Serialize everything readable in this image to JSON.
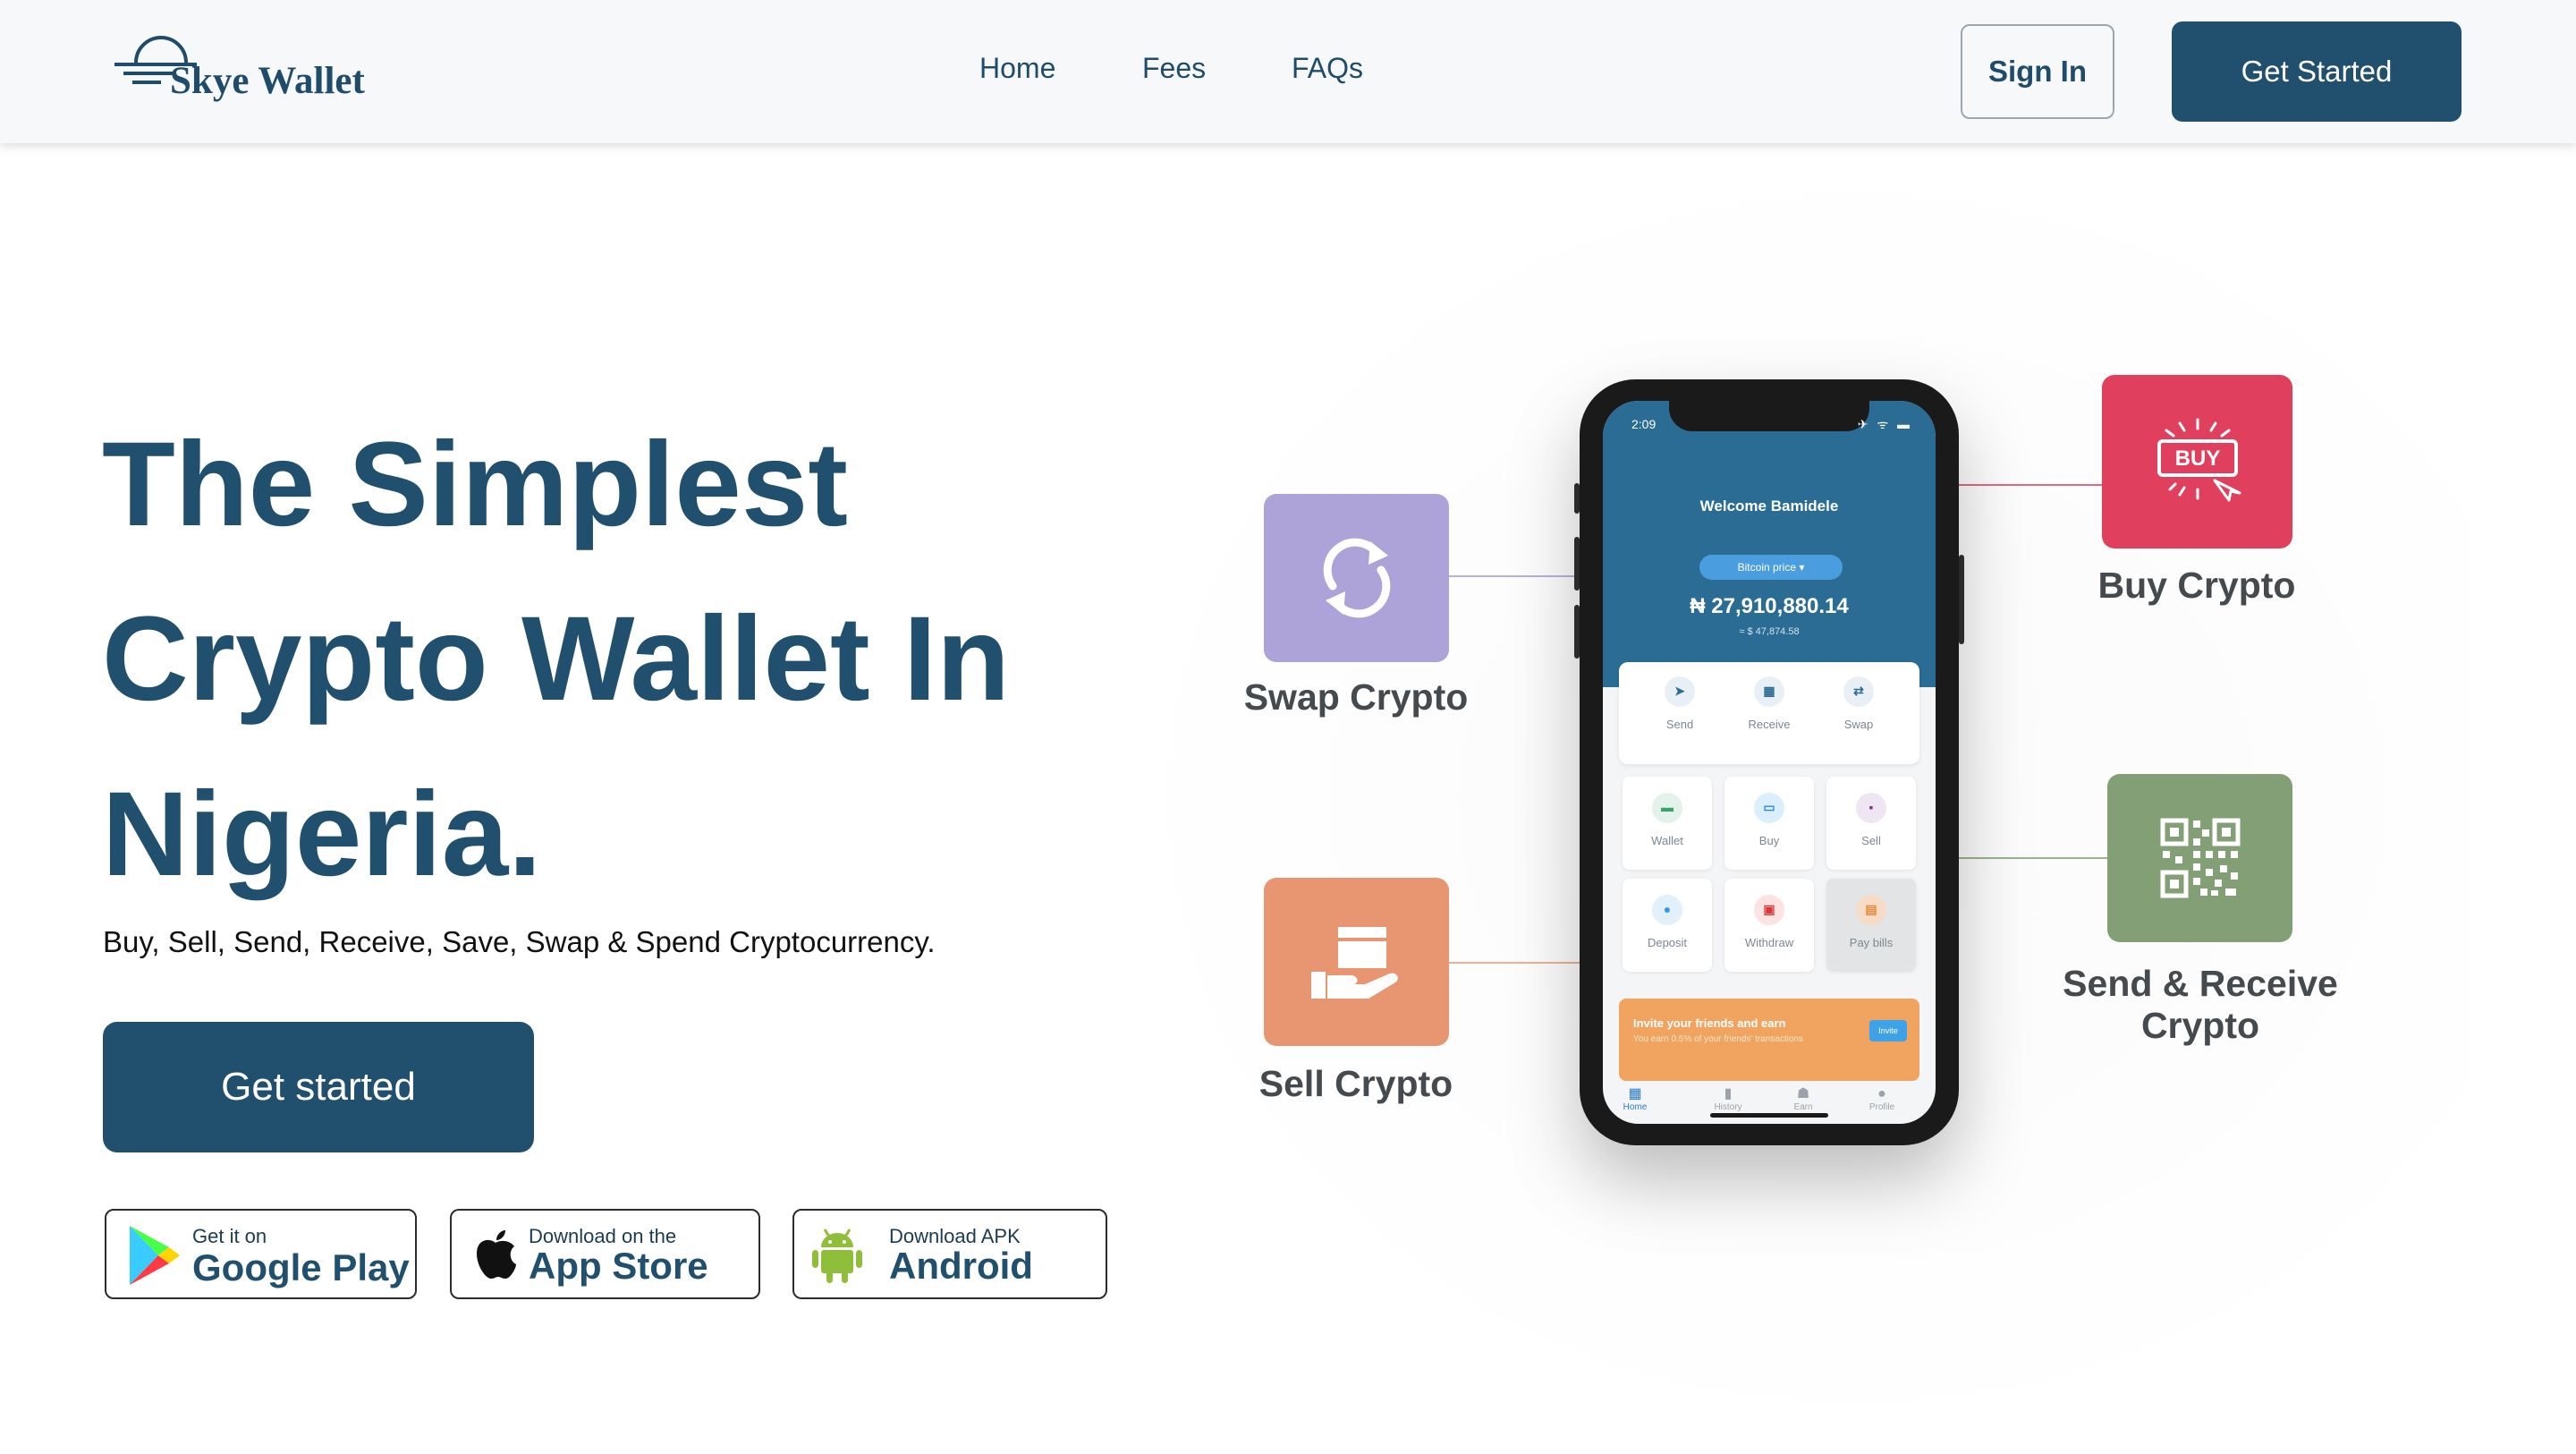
{
  "header": {
    "logo_text": "Skye Wallet",
    "nav": [
      "Home",
      "Fees",
      "FAQs"
    ],
    "sign_in_label": "Sign In",
    "get_started_label": "Get Started"
  },
  "hero": {
    "title_lines": [
      "The Simplest",
      "Crypto Wallet In",
      "Nigeria."
    ],
    "subtitle": "Buy, Sell, Send, Receive, Save, Swap & Spend Cryptocurrency.",
    "cta_label": "Get started"
  },
  "stores": [
    {
      "small": "Get it on",
      "big": "Google Play",
      "icon": "google-play-icon"
    },
    {
      "small": "Download on the",
      "big": "App Store",
      "icon": "apple-icon"
    },
    {
      "small": "Download APK",
      "big": "Android",
      "icon": "android-icon"
    }
  ],
  "features": {
    "swap": {
      "label": "Swap Crypto",
      "color": "#ada3d9",
      "icon": "swap-icon"
    },
    "buy": {
      "label": "Buy Crypto",
      "color": "#e03f5e",
      "icon": "buy-tag-icon",
      "icon_text": "BUY"
    },
    "sell": {
      "label": "Sell Crypto",
      "color": "#e89671",
      "icon": "hand-box-icon"
    },
    "send_receive": {
      "label_line1": "Send & Receive",
      "label_line2": "Crypto",
      "color": "#829f75",
      "icon": "qr-code-icon"
    }
  },
  "phone": {
    "time": "2:09",
    "status_icons": "✈ ᯤ ▬",
    "welcome": "Welcome Bamidele",
    "price_pill": "Bitcoin price ▾",
    "balance": "₦ 27,910,880.14",
    "balance_usd": "≈ $ 47,874.58",
    "actions": [
      "Send",
      "Receive",
      "Swap"
    ],
    "grid": [
      "Wallet",
      "Buy",
      "Sell",
      "Deposit",
      "Withdraw",
      "Pay bills"
    ],
    "invite_title": "Invite your friends and earn",
    "invite_sub": "You earn 0.5% of your friends' transactions",
    "invite_button": "Invite",
    "tabs": [
      "Home",
      "History",
      "Earn",
      "Profile"
    ]
  }
}
